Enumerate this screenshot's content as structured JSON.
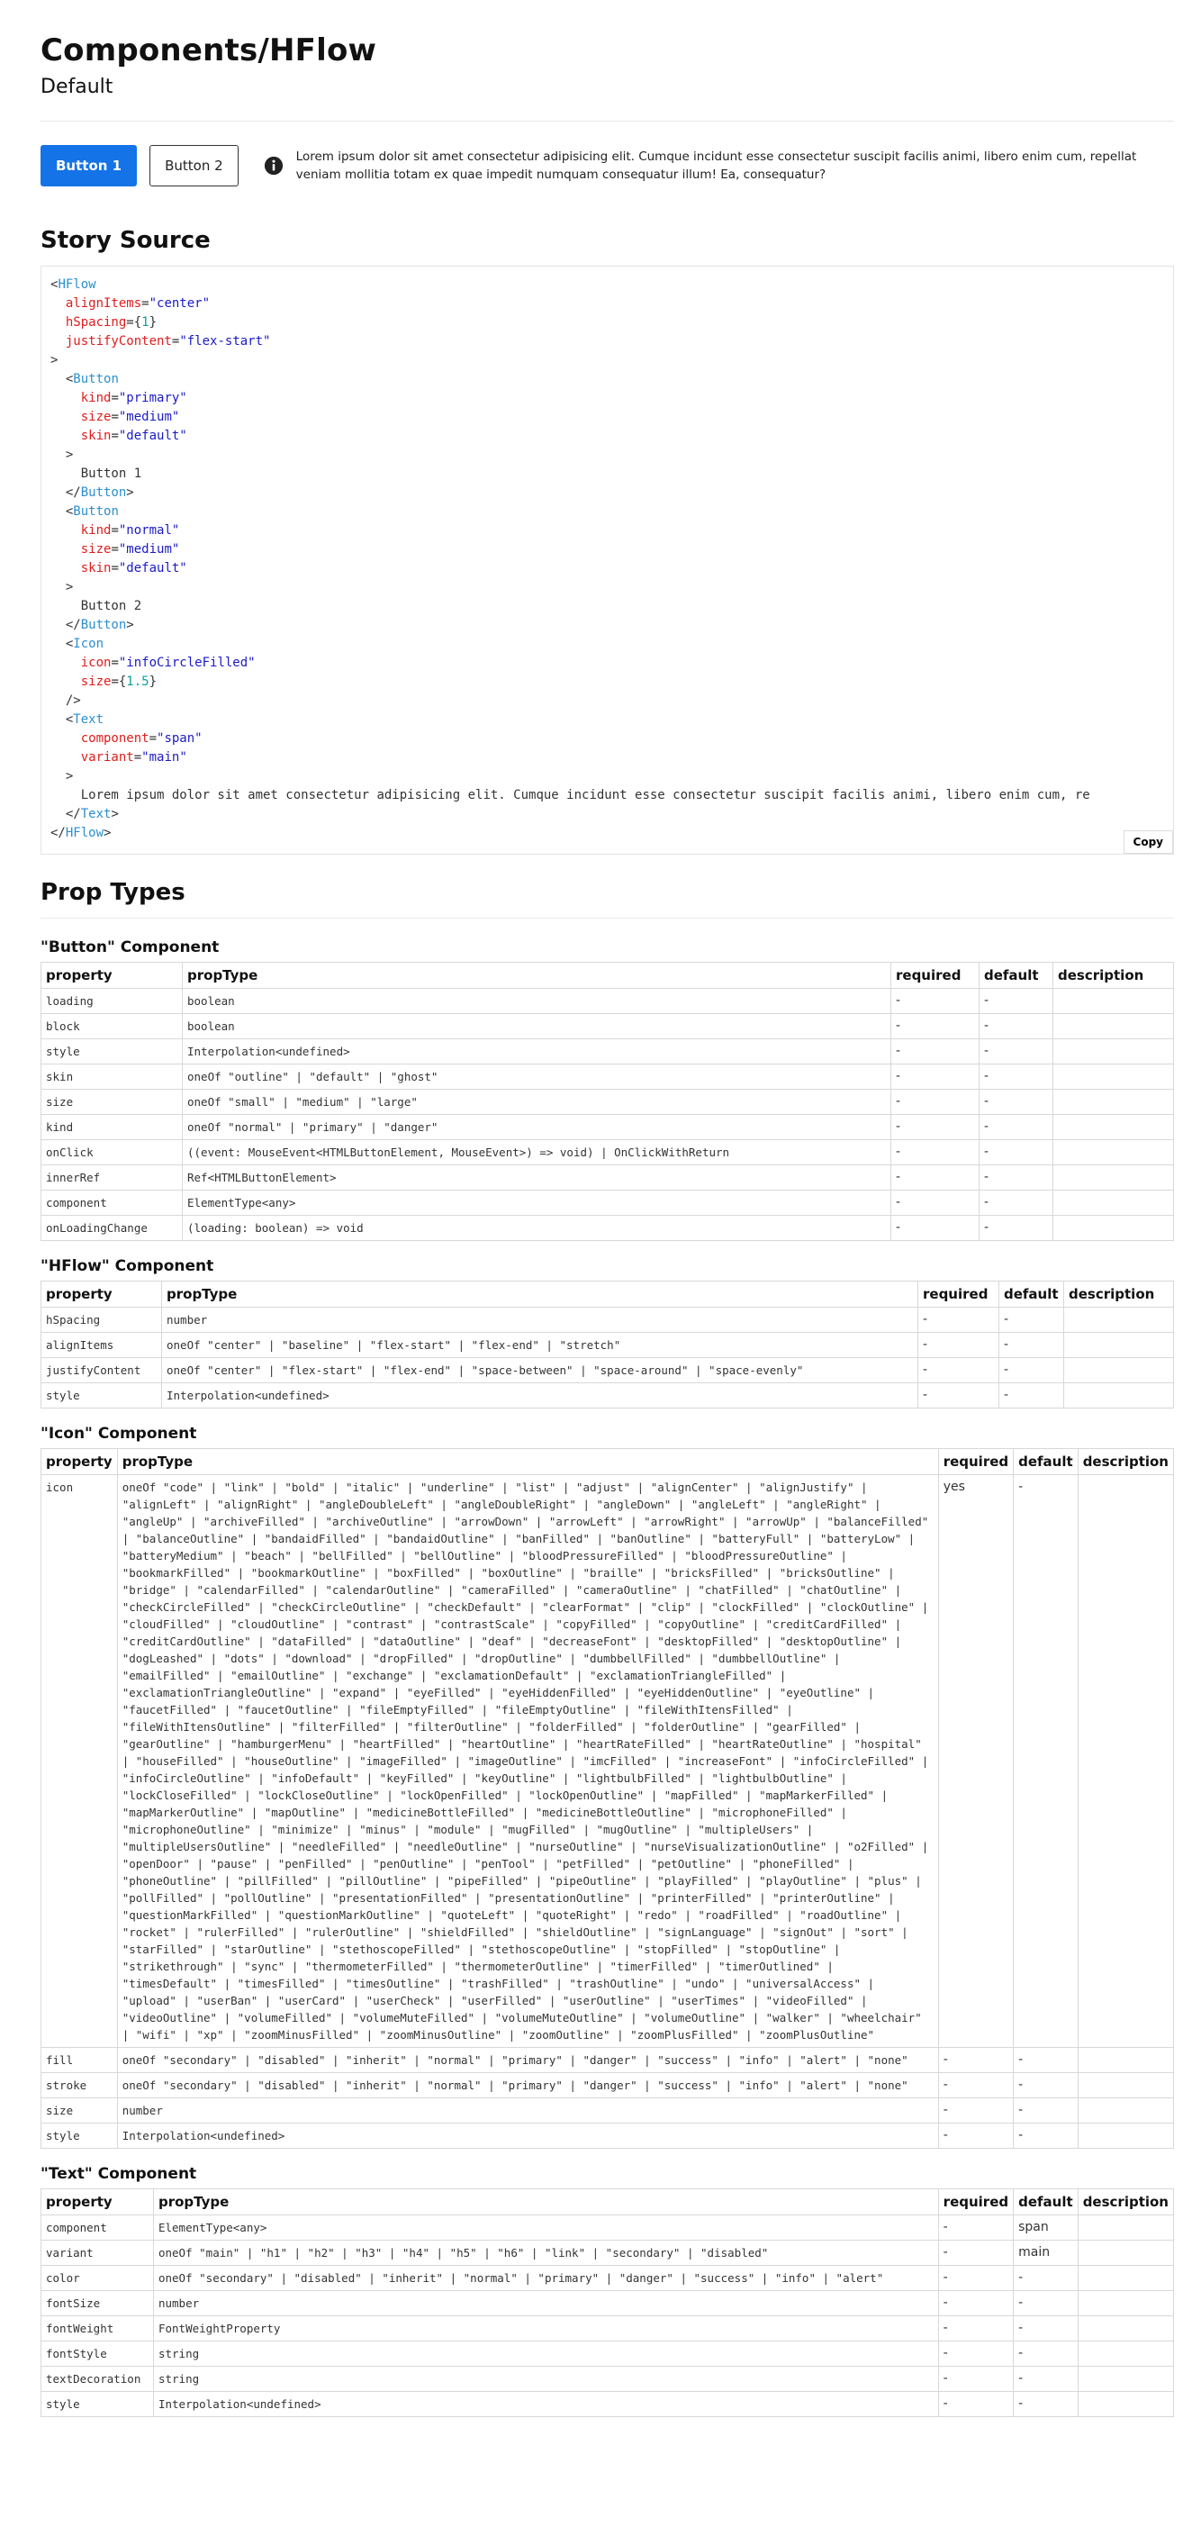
{
  "header": {
    "title": "Components/HFlow",
    "subtitle": "Default"
  },
  "preview": {
    "button1_label": "Button 1",
    "button2_label": "Button 2",
    "info_icon": "info-circle-filled-icon",
    "lorem": "Lorem ipsum dolor sit amet consectetur adipisicing elit. Cumque incidunt esse consectetur suscipit facilis animi, libero enim cum, repellat veniam mollitia totam ex quae impedit numquam consequatur illum! Ea, consequatur?"
  },
  "story_source": {
    "heading": "Story Source",
    "copy_label": "Copy",
    "lines": [
      [
        [
          "p",
          "<"
        ],
        [
          "t",
          "HFlow"
        ]
      ],
      [
        [
          "i",
          "  "
        ],
        [
          "a",
          "alignItems"
        ],
        [
          "p",
          "="
        ],
        [
          "s",
          "\"center\""
        ]
      ],
      [
        [
          "i",
          "  "
        ],
        [
          "a",
          "hSpacing"
        ],
        [
          "p",
          "={"
        ],
        [
          "n",
          "1"
        ],
        [
          "p",
          "}"
        ]
      ],
      [
        [
          "i",
          "  "
        ],
        [
          "a",
          "justifyContent"
        ],
        [
          "p",
          "="
        ],
        [
          "s",
          "\"flex-start\""
        ]
      ],
      [
        [
          "p",
          ">"
        ]
      ],
      [
        [
          "i",
          "  "
        ],
        [
          "p",
          "<"
        ],
        [
          "t",
          "Button"
        ]
      ],
      [
        [
          "i",
          "    "
        ],
        [
          "a",
          "kind"
        ],
        [
          "p",
          "="
        ],
        [
          "s",
          "\"primary\""
        ]
      ],
      [
        [
          "i",
          "    "
        ],
        [
          "a",
          "size"
        ],
        [
          "p",
          "="
        ],
        [
          "s",
          "\"medium\""
        ]
      ],
      [
        [
          "i",
          "    "
        ],
        [
          "a",
          "skin"
        ],
        [
          "p",
          "="
        ],
        [
          "s",
          "\"default\""
        ]
      ],
      [
        [
          "i",
          "  "
        ],
        [
          "p",
          ">"
        ]
      ],
      [
        [
          "i",
          "    "
        ],
        [
          "p",
          "Button 1"
        ]
      ],
      [
        [
          "i",
          "  "
        ],
        [
          "p",
          "</"
        ],
        [
          "t",
          "Button"
        ],
        [
          "p",
          ">"
        ]
      ],
      [
        [
          "i",
          "  "
        ],
        [
          "p",
          "<"
        ],
        [
          "t",
          "Button"
        ]
      ],
      [
        [
          "i",
          "    "
        ],
        [
          "a",
          "kind"
        ],
        [
          "p",
          "="
        ],
        [
          "s",
          "\"normal\""
        ]
      ],
      [
        [
          "i",
          "    "
        ],
        [
          "a",
          "size"
        ],
        [
          "p",
          "="
        ],
        [
          "s",
          "\"medium\""
        ]
      ],
      [
        [
          "i",
          "    "
        ],
        [
          "a",
          "skin"
        ],
        [
          "p",
          "="
        ],
        [
          "s",
          "\"default\""
        ]
      ],
      [
        [
          "i",
          "  "
        ],
        [
          "p",
          ">"
        ]
      ],
      [
        [
          "i",
          "    "
        ],
        [
          "p",
          "Button 2"
        ]
      ],
      [
        [
          "i",
          "  "
        ],
        [
          "p",
          "</"
        ],
        [
          "t",
          "Button"
        ],
        [
          "p",
          ">"
        ]
      ],
      [
        [
          "i",
          "  "
        ],
        [
          "p",
          "<"
        ],
        [
          "t",
          "Icon"
        ]
      ],
      [
        [
          "i",
          "    "
        ],
        [
          "a",
          "icon"
        ],
        [
          "p",
          "="
        ],
        [
          "s",
          "\"infoCircleFilled\""
        ]
      ],
      [
        [
          "i",
          "    "
        ],
        [
          "a",
          "size"
        ],
        [
          "p",
          "={"
        ],
        [
          "n",
          "1.5"
        ],
        [
          "p",
          "}"
        ]
      ],
      [
        [
          "i",
          "  "
        ],
        [
          "p",
          "/>"
        ]
      ],
      [
        [
          "i",
          "  "
        ],
        [
          "p",
          "<"
        ],
        [
          "t",
          "Text"
        ]
      ],
      [
        [
          "i",
          "    "
        ],
        [
          "a",
          "component"
        ],
        [
          "p",
          "="
        ],
        [
          "s",
          "\"span\""
        ]
      ],
      [
        [
          "i",
          "    "
        ],
        [
          "a",
          "variant"
        ],
        [
          "p",
          "="
        ],
        [
          "s",
          "\"main\""
        ]
      ],
      [
        [
          "i",
          "  "
        ],
        [
          "p",
          ">"
        ]
      ],
      [
        [
          "i",
          "    "
        ],
        [
          "p",
          "Lorem ipsum dolor sit amet consectetur adipisicing elit. Cumque incidunt esse consectetur suscipit facilis animi, libero enim cum, re"
        ]
      ],
      [
        [
          "i",
          "  "
        ],
        [
          "p",
          "</"
        ],
        [
          "t",
          "Text"
        ],
        [
          "p",
          ">"
        ]
      ],
      [
        [
          "p",
          "</"
        ],
        [
          "t",
          "HFlow"
        ],
        [
          "p",
          ">"
        ]
      ]
    ]
  },
  "prop_types": {
    "heading": "Prop Types",
    "columns": [
      "property",
      "propType",
      "required",
      "default",
      "description"
    ],
    "components": [
      {
        "title": "\"Button\" Component",
        "col_widths": [
          "157px",
          "787px",
          "98px",
          "82px",
          "auto"
        ],
        "rows": [
          [
            "loading",
            "boolean",
            "-",
            "-",
            ""
          ],
          [
            "block",
            "boolean",
            "-",
            "-",
            ""
          ],
          [
            "style",
            "Interpolation<undefined>",
            "-",
            "-",
            ""
          ],
          [
            "skin",
            "oneOf \"outline\" | \"default\" | \"ghost\"",
            "-",
            "-",
            ""
          ],
          [
            "size",
            "oneOf \"small\" | \"medium\" | \"large\"",
            "-",
            "-",
            ""
          ],
          [
            "kind",
            "oneOf \"normal\" | \"primary\" | \"danger\"",
            "-",
            "-",
            ""
          ],
          [
            "onClick",
            "((event: MouseEvent<HTMLButtonElement, MouseEvent>) => void) | OnClickWithReturn",
            "-",
            "-",
            ""
          ],
          [
            "innerRef",
            "Ref<HTMLButtonElement>",
            "-",
            "-",
            ""
          ],
          [
            "component",
            "ElementType<any>",
            "-",
            "-",
            ""
          ],
          [
            "onLoadingChange",
            "(loading: boolean) => void",
            "-",
            "-",
            ""
          ]
        ]
      },
      {
        "title": "\"HFlow\" Component",
        "col_widths": [
          "134px",
          "840px",
          "90px",
          "72px",
          "auto"
        ],
        "rows": [
          [
            "hSpacing",
            "number",
            "-",
            "-",
            ""
          ],
          [
            "alignItems",
            "oneOf \"center\" | \"baseline\" | \"flex-start\" | \"flex-end\" | \"stretch\"",
            "-",
            "-",
            ""
          ],
          [
            "justifyContent",
            "oneOf \"center\" | \"flex-start\" | \"flex-end\" | \"space-between\" | \"space-around\" | \"space-evenly\"",
            "-",
            "-",
            ""
          ],
          [
            "style",
            "Interpolation<undefined>",
            "-",
            "-",
            ""
          ]
        ]
      },
      {
        "title": "\"Icon\" Component",
        "col_widths": [
          "82px",
          "915px",
          "80px",
          "68px",
          "auto"
        ],
        "rows": [
          [
            "icon",
            "oneOf \"code\" | \"link\" | \"bold\" | \"italic\" | \"underline\" | \"list\" | \"adjust\" | \"alignCenter\" | \"alignJustify\" | \"alignLeft\" | \"alignRight\" | \"angleDoubleLeft\" | \"angleDoubleRight\" | \"angleDown\" | \"angleLeft\" | \"angleRight\" | \"angleUp\" | \"archiveFilled\" | \"archiveOutline\" | \"arrowDown\" | \"arrowLeft\" | \"arrowRight\" | \"arrowUp\" | \"balanceFilled\" | \"balanceOutline\" | \"bandaidFilled\" | \"bandaidOutline\" | \"banFilled\" | \"banOutline\" | \"batteryFull\" | \"batteryLow\" | \"batteryMedium\" | \"beach\" | \"bellFilled\" | \"bellOutline\" | \"bloodPressureFilled\" | \"bloodPressureOutline\" | \"bookmarkFilled\" | \"bookmarkOutline\" | \"boxFilled\" | \"boxOutline\" | \"braille\" | \"bricksFilled\" | \"bricksOutline\" | \"bridge\" | \"calendarFilled\" | \"calendarOutline\" | \"cameraFilled\" | \"cameraOutline\" | \"chatFilled\" | \"chatOutline\" | \"checkCircleFilled\" | \"checkCircleOutline\" | \"checkDefault\" | \"clearFormat\" | \"clip\" | \"clockFilled\" | \"clockOutline\" | \"cloudFilled\" | \"cloudOutline\" | \"contrast\" | \"contrastScale\" | \"copyFilled\" | \"copyOutline\" | \"creditCardFilled\" | \"creditCardOutline\" | \"dataFilled\" | \"dataOutline\" | \"deaf\" | \"decreaseFont\" | \"desktopFilled\" | \"desktopOutline\" | \"dogLeashed\" | \"dots\" | \"download\" | \"dropFilled\" | \"dropOutline\" | \"dumbbellFilled\" | \"dumbbellOutline\" | \"emailFilled\" | \"emailOutline\" | \"exchange\" | \"exclamationDefault\" | \"exclamationTriangleFilled\" | \"exclamationTriangleOutline\" | \"expand\" | \"eyeFilled\" | \"eyeHiddenFilled\" | \"eyeHiddenOutline\" | \"eyeOutline\" | \"faucetFilled\" | \"faucetOutline\" | \"fileEmptyFilled\" | \"fileEmptyOutline\" | \"fileWithItensFilled\" | \"fileWithItensOutline\" | \"filterFilled\" | \"filterOutline\" | \"folderFilled\" | \"folderOutline\" | \"gearFilled\" | \"gearOutline\" | \"hamburgerMenu\" | \"heartFilled\" | \"heartOutline\" | \"heartRateFilled\" | \"heartRateOutline\" | \"hospital\" | \"houseFilled\" | \"houseOutline\" | \"imageFilled\" | \"imageOutline\" | \"imcFilled\" | \"increaseFont\" | \"infoCircleFilled\" | \"infoCircleOutline\" | \"infoDefault\" | \"keyFilled\" | \"keyOutline\" | \"lightbulbFilled\" | \"lightbulbOutline\" | \"lockCloseFilled\" | \"lockCloseOutline\" | \"lockOpenFilled\" | \"lockOpenOutline\" | \"mapFilled\" | \"mapMarkerFilled\" | \"mapMarkerOutline\" | \"mapOutline\" | \"medicineBottleFilled\" | \"medicineBottleOutline\" | \"microphoneFilled\" | \"microphoneOutline\" | \"minimize\" | \"minus\" | \"module\" | \"mugFilled\" | \"mugOutline\" | \"multipleUsers\" | \"multipleUsersOutline\" | \"needleFilled\" | \"needleOutline\" | \"nurseOutline\" | \"nurseVisualizationOutline\" | \"o2Filled\" | \"openDoor\" | \"pause\" | \"penFilled\" | \"penOutline\" | \"penTool\" | \"petFilled\" | \"petOutline\" | \"phoneFilled\" | \"phoneOutline\" | \"pillFilled\" | \"pillOutline\" | \"pipeFilled\" | \"pipeOutline\" | \"playFilled\" | \"playOutline\" | \"plus\" | \"pollFilled\" | \"pollOutline\" | \"presentationFilled\" | \"presentationOutline\" | \"printerFilled\" | \"printerOutline\" | \"questionMarkFilled\" | \"questionMarkOutline\" | \"quoteLeft\" | \"quoteRight\" | \"redo\" | \"roadFilled\" | \"roadOutline\" | \"rocket\" | \"rulerFilled\" | \"rulerOutline\" | \"shieldFilled\" | \"shieldOutline\" | \"signLanguage\" | \"signOut\" | \"sort\" | \"starFilled\" | \"starOutline\" | \"stethoscopeFilled\" | \"stethoscopeOutline\" | \"stopFilled\" | \"stopOutline\" | \"strikethrough\" | \"sync\" | \"thermometerFilled\" | \"thermometerOutline\" | \"timerFilled\" | \"timerOutlined\" | \"timesDefault\" | \"timesFilled\" | \"timesOutline\" | \"trashFilled\" | \"trashOutline\" | \"undo\" | \"universalAccess\" | \"upload\" | \"userBan\" | \"userCard\" | \"userCheck\" | \"userFilled\" | \"userOutline\" | \"userTimes\" | \"videoFilled\" | \"videoOutline\" | \"volumeFilled\" | \"volumeMuteFilled\" | \"volumeMuteOutline\" | \"volumeOutline\" | \"walker\" | \"wheelchair\" | \"wifi\" | \"xp\" | \"zoomMinusFilled\" | \"zoomMinusOutline\" | \"zoomOutline\" | \"zoomPlusFilled\" | \"zoomPlusOutline\"",
            "yes",
            "-",
            ""
          ],
          [
            "fill",
            "oneOf \"secondary\" | \"disabled\" | \"inherit\" | \"normal\" | \"primary\" | \"danger\" | \"success\" | \"info\" | \"alert\" | \"none\"",
            "-",
            "-",
            ""
          ],
          [
            "stroke",
            "oneOf \"secondary\" | \"disabled\" | \"inherit\" | \"normal\" | \"primary\" | \"danger\" | \"success\" | \"info\" | \"alert\" | \"none\"",
            "-",
            "-",
            ""
          ],
          [
            "size",
            "number",
            "-",
            "-",
            ""
          ],
          [
            "style",
            "Interpolation<undefined>",
            "-",
            "-",
            ""
          ]
        ]
      },
      {
        "title": "\"Text\" Component",
        "col_widths": [
          "125px",
          "872px",
          "82px",
          "68px",
          "auto"
        ],
        "rows": [
          [
            "component",
            "ElementType<any>",
            "-",
            "span",
            ""
          ],
          [
            "variant",
            "oneOf \"main\" | \"h1\" | \"h2\" | \"h3\" | \"h4\" | \"h5\" | \"h6\" | \"link\" | \"secondary\" | \"disabled\"",
            "-",
            "main",
            ""
          ],
          [
            "color",
            "oneOf \"secondary\" | \"disabled\" | \"inherit\" | \"normal\" | \"primary\" | \"danger\" | \"success\" | \"info\" | \"alert\"",
            "-",
            "-",
            ""
          ],
          [
            "fontSize",
            "number",
            "-",
            "-",
            ""
          ],
          [
            "fontWeight",
            "FontWeightProperty",
            "-",
            "-",
            ""
          ],
          [
            "fontStyle",
            "string",
            "-",
            "-",
            ""
          ],
          [
            "textDecoration",
            "string",
            "-",
            "-",
            ""
          ],
          [
            "style",
            "Interpolation<undefined>",
            "-",
            "-",
            ""
          ]
        ]
      }
    ]
  },
  "colors": {
    "primary": "#1473e6",
    "code_tag": "#2a8fd0",
    "code_attr": "#e01c1c",
    "code_string": "#1a1ac8",
    "code_number": "#0a9e9e"
  }
}
